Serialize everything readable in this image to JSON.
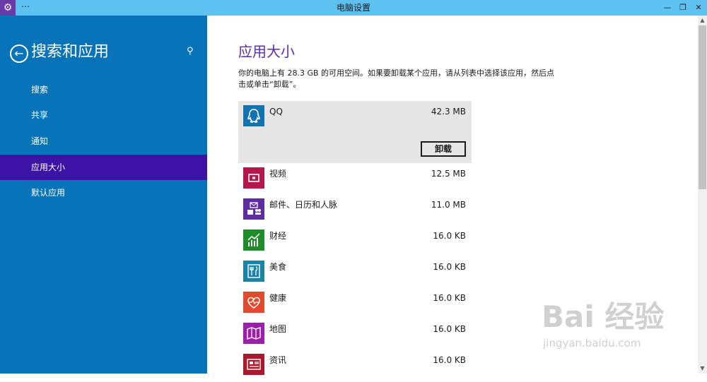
{
  "window": {
    "title": "电脑设置",
    "menu_glyph": "⋯",
    "app_icon": "gear-icon",
    "controls": {
      "minimize": "—",
      "restore": "❐",
      "close": "✕"
    }
  },
  "sidebar": {
    "title": "搜索和应用",
    "back_icon": "back-arrow-icon",
    "search_icon": "search-icon",
    "items": [
      {
        "label": "搜索",
        "active": false
      },
      {
        "label": "共享",
        "active": false
      },
      {
        "label": "通知",
        "active": false
      },
      {
        "label": "应用大小",
        "active": true
      },
      {
        "label": "默认应用",
        "active": false
      }
    ],
    "colors": {
      "background": "#0773b8",
      "active": "#3d13a6"
    }
  },
  "main": {
    "title": "应用大小",
    "description": "你的电脑上有 28.3 GB 的可用空间。如果要卸载某个应用，请从列表中选择该应用，然后点击或单击“卸载”。",
    "uninstall_label": "卸载",
    "apps": [
      {
        "name": "QQ",
        "size": "42.3 MB",
        "icon": "qq-icon",
        "color": "#1273b0",
        "selected": true
      },
      {
        "name": "视频",
        "size": "12.5 MB",
        "icon": "video-icon",
        "color": "#b5174d"
      },
      {
        "name": "邮件、日历和人脉",
        "size": "11.0 MB",
        "icon": "mail-people-icon",
        "color": "#5d2c9e"
      },
      {
        "name": "财经",
        "size": "16.0 KB",
        "icon": "finance-chart-icon",
        "color": "#1f8c2a"
      },
      {
        "name": "美食",
        "size": "16.0 KB",
        "icon": "food-icon",
        "color": "#1a84a5"
      },
      {
        "name": "健康",
        "size": "16.0 KB",
        "icon": "health-icon",
        "color": "#e04b2e"
      },
      {
        "name": "地图",
        "size": "16.0 KB",
        "icon": "map-icon",
        "color": "#9b1fa8"
      },
      {
        "name": "资讯",
        "size": "16.0 KB",
        "icon": "news-icon",
        "color": "#a8192e"
      }
    ]
  },
  "watermark": {
    "main": "Bai 经验",
    "sub": "jingyan.baidu.com"
  }
}
